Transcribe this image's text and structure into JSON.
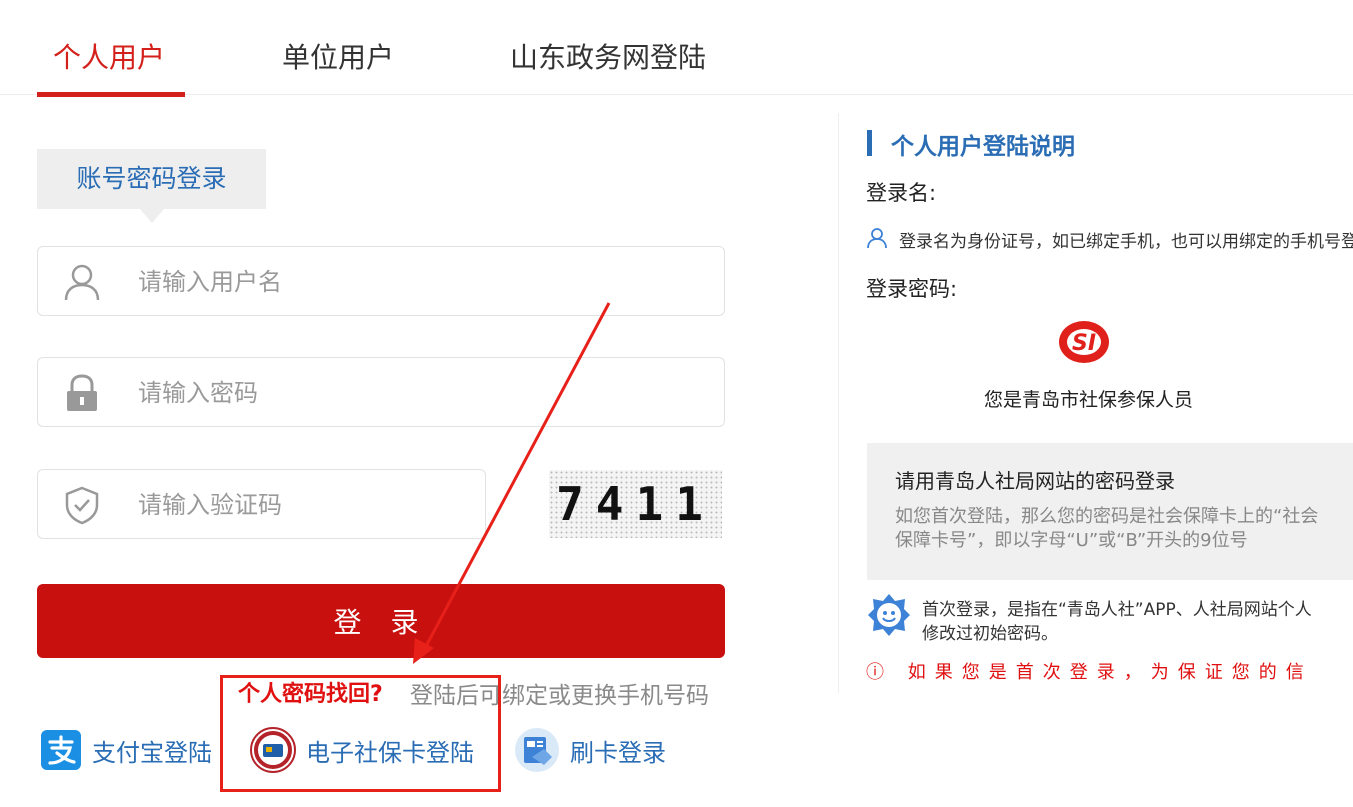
{
  "tabs": [
    {
      "label": "个人用户",
      "active": true
    },
    {
      "label": "单位用户",
      "active": false
    },
    {
      "label": "山东政务网登陆",
      "active": false
    }
  ],
  "login_mode": "账号密码登录",
  "fields": {
    "username_placeholder": "请输入用户名",
    "password_placeholder": "请输入密码",
    "captcha_placeholder": "请输入验证码"
  },
  "captcha_text": "7411",
  "login_button": "登 录",
  "forgot_password": "个人密码找回?",
  "bind_phone_hint": "登陆后可绑定或更换手机号码",
  "alt_logins": [
    {
      "label": "支付宝登陆",
      "icon": "alipay-icon"
    },
    {
      "label": "电子社保卡登陆",
      "icon": "social-security-card-icon"
    },
    {
      "label": "刷卡登录",
      "icon": "card-reader-icon"
    }
  ],
  "info_panel": {
    "title": "个人用户登陆说明",
    "username_heading": "登录名:",
    "username_desc": "登录名为身份证号，如已绑定手机，也可以用绑定的手机号登",
    "password_heading": "登录密码:",
    "si_logo_text": "SI",
    "insured_title": "您是青岛市社保参保人员",
    "website_pwd_title": "请用青岛人社局网站的密码登录",
    "website_pwd_desc": "如您首次登陆，那么您的密码是社会保障卡上的“社会保障卡号”，即以字母“U”或“B”开头的9位号",
    "first_login_note_1": "首次登录，是指在“青岛人社”APP、人社局网站个人",
    "first_login_note_2": "修改过初始密码。",
    "warning": "ⓘ 如果您是首次登录，为保证您的信"
  },
  "colors": {
    "accent_red": "#d4201a",
    "button_red": "#c8100f",
    "link_blue": "#2a6db5"
  }
}
